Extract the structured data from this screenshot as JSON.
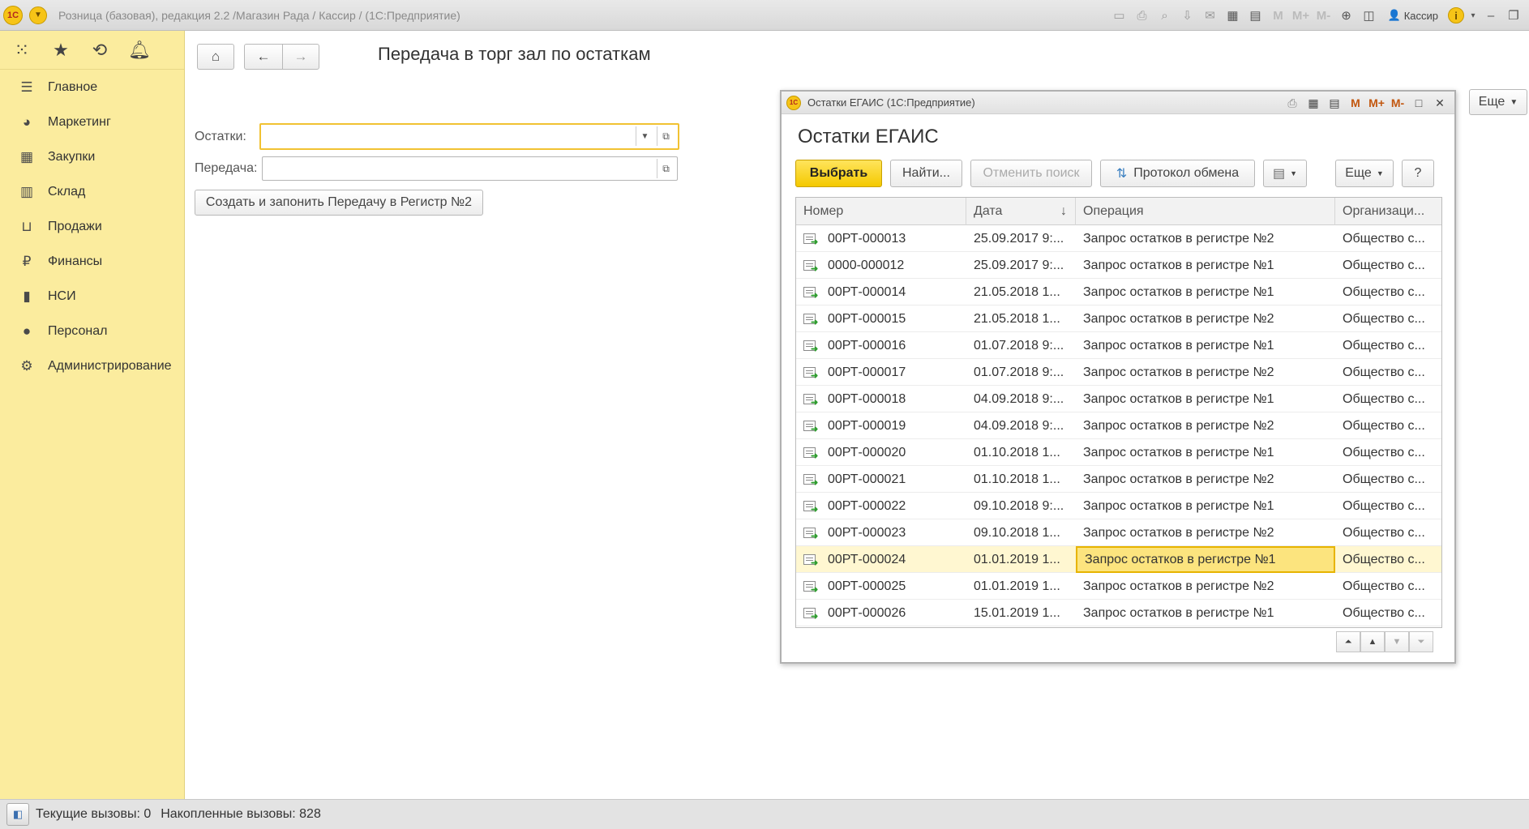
{
  "window": {
    "title": "Розница (базовая), редакция 2.2 /Магазин Рада / Кассир /  (1С:Предприятие)",
    "user": "Кассир",
    "logo_text": "1C"
  },
  "sidebar": {
    "top_icons": [
      "apps-grid-icon",
      "star-icon",
      "history-icon",
      "bell-icon"
    ],
    "items": [
      {
        "label": "Главное",
        "icon": "menu-icon"
      },
      {
        "label": "Маркетинг",
        "icon": "pie-chart-icon"
      },
      {
        "label": "Закупки",
        "icon": "purchases-icon"
      },
      {
        "label": "Склад",
        "icon": "warehouse-icon"
      },
      {
        "label": "Продажи",
        "icon": "basket-icon"
      },
      {
        "label": "Финансы",
        "icon": "ruble-icon"
      },
      {
        "label": "НСИ",
        "icon": "books-icon"
      },
      {
        "label": "Персонал",
        "icon": "person-icon"
      },
      {
        "label": "Администрирование",
        "icon": "gear-icon"
      }
    ]
  },
  "form": {
    "title": "Передача в торг зал по остаткам",
    "fields": {
      "ostatki_label": "Остатки:",
      "ostatki_value": "",
      "peredacha_label": "Передача:",
      "peredacha_value": ""
    },
    "create_button": "Создать и запонить Передачу в Регистр №2",
    "more_button": "Еще"
  },
  "modal": {
    "window_title": "Остатки ЕГАИС  (1С:Предприятие)",
    "heading": "Остатки ЕГАИС",
    "buttons": {
      "select": "Выбрать",
      "find": "Найти...",
      "cancel_search": "Отменить поиск",
      "protocol": "Протокол обмена",
      "more": "Еще",
      "help": "?"
    },
    "table": {
      "columns": [
        "Номер",
        "Дата",
        "Операция",
        "Организаци..."
      ],
      "rows": [
        {
          "number": "00РТ-000013",
          "date": "25.09.2017 9:...",
          "operation": "Запрос остатков в регистре №2",
          "org": "Общество с..."
        },
        {
          "number": "0000-000012",
          "date": "25.09.2017 9:...",
          "operation": "Запрос остатков в регистре №1",
          "org": "Общество с..."
        },
        {
          "number": "00РТ-000014",
          "date": "21.05.2018 1...",
          "operation": "Запрос остатков в регистре №1",
          "org": "Общество с..."
        },
        {
          "number": "00РТ-000015",
          "date": "21.05.2018 1...",
          "operation": "Запрос остатков в регистре №2",
          "org": "Общество с..."
        },
        {
          "number": "00РТ-000016",
          "date": "01.07.2018 9:...",
          "operation": "Запрос остатков в регистре №1",
          "org": "Общество с..."
        },
        {
          "number": "00РТ-000017",
          "date": "01.07.2018 9:...",
          "operation": "Запрос остатков в регистре №2",
          "org": "Общество с..."
        },
        {
          "number": "00РТ-000018",
          "date": "04.09.2018 9:...",
          "operation": "Запрос остатков в регистре №1",
          "org": "Общество с..."
        },
        {
          "number": "00РТ-000019",
          "date": "04.09.2018 9:...",
          "operation": "Запрос остатков в регистре №2",
          "org": "Общество с..."
        },
        {
          "number": "00РТ-000020",
          "date": "01.10.2018 1...",
          "operation": "Запрос остатков в регистре №1",
          "org": "Общество с..."
        },
        {
          "number": "00РТ-000021",
          "date": "01.10.2018 1...",
          "operation": "Запрос остатков в регистре №2",
          "org": "Общество с..."
        },
        {
          "number": "00РТ-000022",
          "date": "09.10.2018 9:...",
          "operation": "Запрос остатков в регистре №1",
          "org": "Общество с..."
        },
        {
          "number": "00РТ-000023",
          "date": "09.10.2018 1...",
          "operation": "Запрос остатков в регистре №2",
          "org": "Общество с..."
        },
        {
          "number": "00РТ-000024",
          "date": "01.01.2019 1...",
          "operation": "Запрос остатков в регистре №1",
          "org": "Общество с...",
          "selected": true
        },
        {
          "number": "00РТ-000025",
          "date": "01.01.2019 1...",
          "operation": "Запрос остатков в регистре №2",
          "org": "Общество с..."
        },
        {
          "number": "00РТ-000026",
          "date": "15.01.2019 1...",
          "operation": "Запрос остатков в регистре №1",
          "org": "Общество с..."
        }
      ]
    }
  },
  "statusbar": {
    "current_calls": "Текущие вызовы: 0",
    "accumulated_calls": "Накопленные вызовы: 828"
  },
  "colors": {
    "sidebar_bg": "#fbec9e",
    "primary_button": "#f4c900",
    "selection": "#fce47e"
  }
}
